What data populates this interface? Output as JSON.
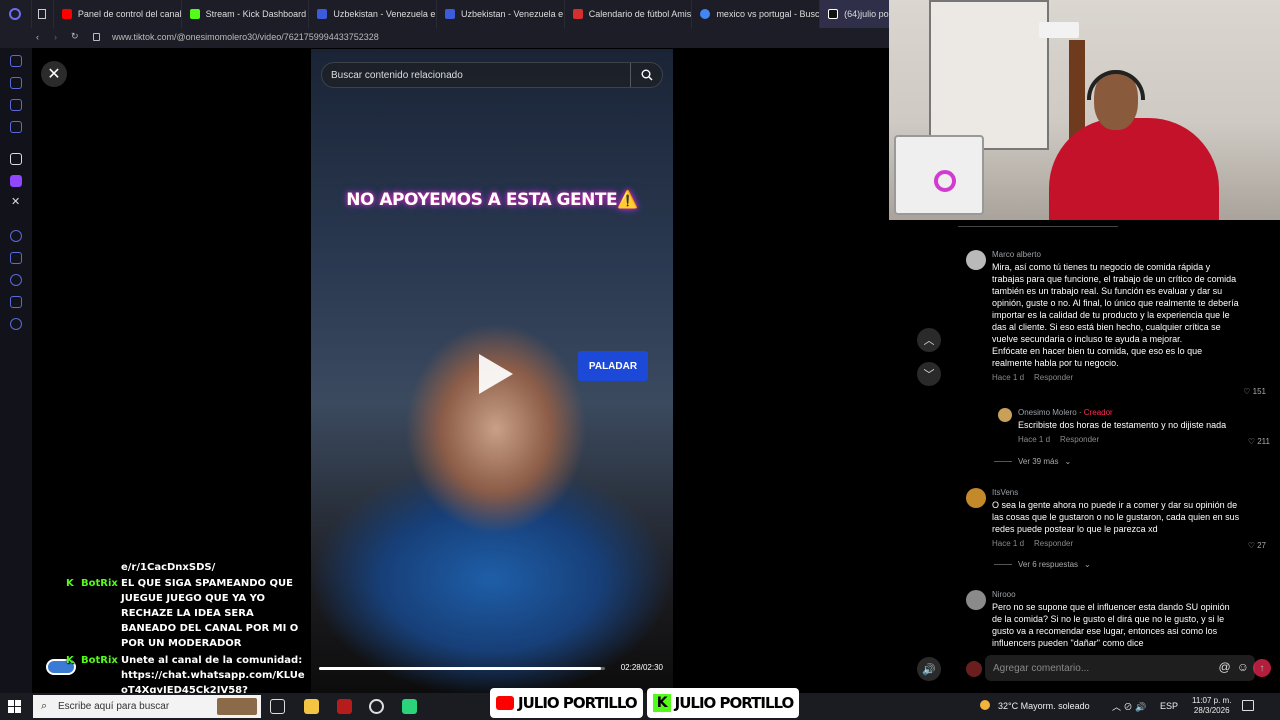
{
  "browser": {
    "tabs": [
      {
        "label": "Panel de control del canal",
        "color": "#ff0000"
      },
      {
        "label": "Stream - Kick Dashboard",
        "color": "#53fc18"
      },
      {
        "label": "Uzbekistan - Venezuela e",
        "color": "#3b5bdb"
      },
      {
        "label": "Uzbekistan - Venezuela e",
        "color": "#3b5bdb"
      },
      {
        "label": "Calendario de fútbol Amis",
        "color": "#d32f2f"
      },
      {
        "label": "mexico vs portugal - Busc",
        "color": "#4285f4"
      },
      {
        "label": "(64)julio por",
        "color": "#ffffff"
      }
    ],
    "url": "www.tiktok.com/@onesimomolero30/video/7621759994433752328"
  },
  "video": {
    "search_placeholder": "Buscar contenido relacionado",
    "caption": "NO APOYEMOS A ESTA GENTE⚠️",
    "sign_text": "PALADAR",
    "time": "02:28/02:30",
    "progress": 0.987
  },
  "comments": [
    {
      "author": "Marco alberto",
      "text": "Mira, así como tú tienes tu negocio de comida rápida y trabajas para que funcione, el trabajo de un crítico de comida también es un trabajo real. Su función es evaluar y dar su opinión, guste o no. Al final, lo único que realmente te debería importar es la calidad de tu producto y la experiencia que le das al cliente. Si eso está bien hecho, cualquier crítica se vuelve secundaria o incluso te ayuda a mejorar.\nEnfócate en hacer bien tu comida, que eso es lo que realmente habla por tu negocio.",
      "time": "Hace 1 d",
      "reply": "Responder",
      "likes": "151"
    },
    {
      "author": "Onesimo Molero",
      "badge": "Creador",
      "text": "Escribiste dos horas de testamento y no dijiste nada",
      "time": "Hace 1 d",
      "reply": "Responder",
      "likes": "211"
    },
    {
      "author": "ItsVens",
      "text": "O sea la gente ahora no puede ir a comer y dar su opinión de las cosas que le gustaron o no le gustaron, cada quien en sus redes puede postear lo que le parezca xd",
      "time": "Hace 1 d",
      "reply": "Responder",
      "likes": "27"
    },
    {
      "author": "Nirooo",
      "text": "Pero no se supone que el influencer esta dando SU opinión de la comida? Si no le gusto el dirá que no le gusto, y si le gusto va a recomendar ese lugar, entonces asi como los influencers pueden \"dañar\" como dice"
    }
  ],
  "more_links": [
    "Ver 39 más",
    "Ver 6 respuestas"
  ],
  "comment_input_placeholder": "Agregar comentario...",
  "chat": {
    "top_fragment": "e/r/1CacDnxSDS/",
    "messages": [
      {
        "user": "BotRix",
        "text": "EL QUE SIGA SPAMEANDO QUE JUEGUE JUEGO QUE YA YO RECHAZE LA IDEA SERA BANEADO DEL CANAL POR MI O POR UN MODERADOR"
      },
      {
        "user": "BotRix",
        "text": "Unete al canal de la comunidad: https://chat.whatsapp.com/KLUeoT4XgyIED45Ck2IV58?"
      }
    ]
  },
  "taskbar": {
    "search_placeholder": "Escribe aquí para buscar",
    "weather": "32°C  Mayorm. soleado",
    "lang": "ESP",
    "time": "11:07 p. m.",
    "date": "28/3/2026"
  },
  "brand": {
    "name_1": "JULIO PORTILLO",
    "name_2": "JULIO PORTILLO"
  }
}
